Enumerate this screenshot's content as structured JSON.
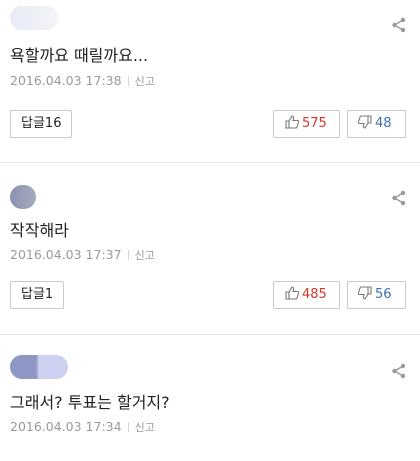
{
  "comments": [
    {
      "text": "욕할까요 때릴까요...",
      "date": "2016.04.03 17:38",
      "report_label": "신고",
      "reply_label": "답글16",
      "likes": "575",
      "dislikes": "48",
      "avatar_colors": [
        "#e8ebf6",
        "#f3f4f8"
      ],
      "has_buttons": true
    },
    {
      "text": "작작해라",
      "date": "2016.04.03 17:37",
      "report_label": "신고",
      "reply_label": "답글1",
      "likes": "485",
      "dislikes": "56",
      "avatar_colors": [
        "#8a93ad",
        "#a5abc0"
      ],
      "has_buttons": true
    },
    {
      "text": "그래서? 투표는 할거지?",
      "date": "2016.04.03 17:34",
      "report_label": "신고",
      "avatar_colors": [
        "#8d97c4",
        "#cdd1f0"
      ],
      "has_buttons": false
    }
  ],
  "icons": {
    "share": "share-icon",
    "like": "thumbs-up-icon",
    "dislike": "thumbs-down-icon"
  }
}
